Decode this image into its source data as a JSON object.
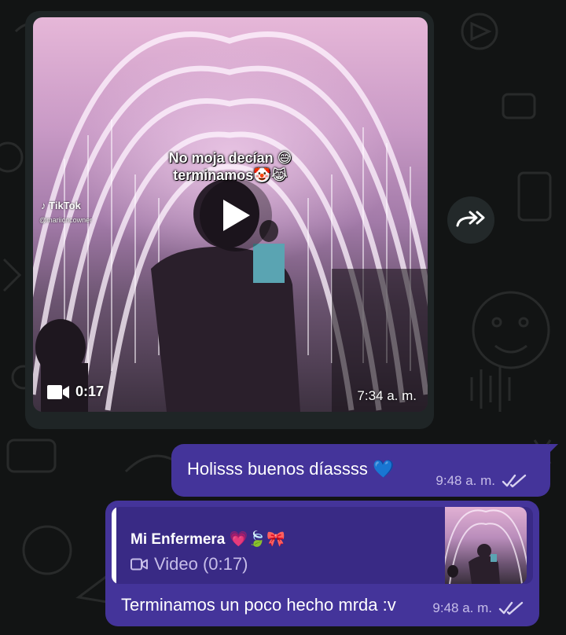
{
  "chat": {
    "video_message": {
      "caption_line1": "No moja decían 😅",
      "caption_line2": "terminamos🤡😹",
      "tiktok_logo": "TikTok",
      "tiktok_handle": "@mariicncowner",
      "duration": "0:17",
      "time": "7:34 a. m."
    },
    "message_1": {
      "text": "Holisss buenos díassss 💙",
      "time": "9:48 a. m.",
      "status": "read"
    },
    "message_2": {
      "reply_to_name": "Mi Enfermera 💗🍃🎀",
      "reply_to_preview": "Video (0:17)",
      "text": "Terminamos un poco hecho mrda :v",
      "time": "9:48 a. m.",
      "status": "read"
    }
  },
  "colors": {
    "background": "#121414",
    "incoming_bubble": "#1f2526",
    "outgoing_bubble": "#44349a",
    "reply_box": "#392a85",
    "meta_text": "#c6bde8"
  },
  "icons": [
    "play-icon",
    "video-camera-icon",
    "forward-icon",
    "double-check-icon",
    "tiktok-icon"
  ]
}
